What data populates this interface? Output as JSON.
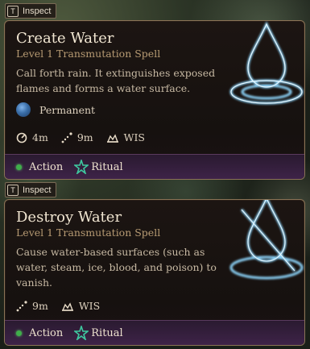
{
  "cards": [
    {
      "inspect_key": "T",
      "inspect_label": "Inspect",
      "title": "Create Water",
      "subtitle": "Level 1 Transmutation Spell",
      "description": "Call forth rain. It extinguishes exposed flames and forms a water surface.",
      "duration": "Permanent",
      "stats": {
        "radius": "4m",
        "range": "9m",
        "save": "WIS"
      },
      "action": "Action",
      "ritual": "Ritual"
    },
    {
      "inspect_key": "T",
      "inspect_label": "Inspect",
      "title": "Destroy Water",
      "subtitle": "Level 1 Transmutation Spell",
      "description": "Cause water-based surfaces (such as water, steam, ice, blood, and poison) to vanish.",
      "stats": {
        "range": "9m",
        "save": "WIS"
      },
      "action": "Action",
      "ritual": "Ritual"
    }
  ],
  "colors": {
    "action_dot": "#3fae4a",
    "ritual_icon": "#3ec9a0",
    "water_glow": "#7fd0ff"
  }
}
